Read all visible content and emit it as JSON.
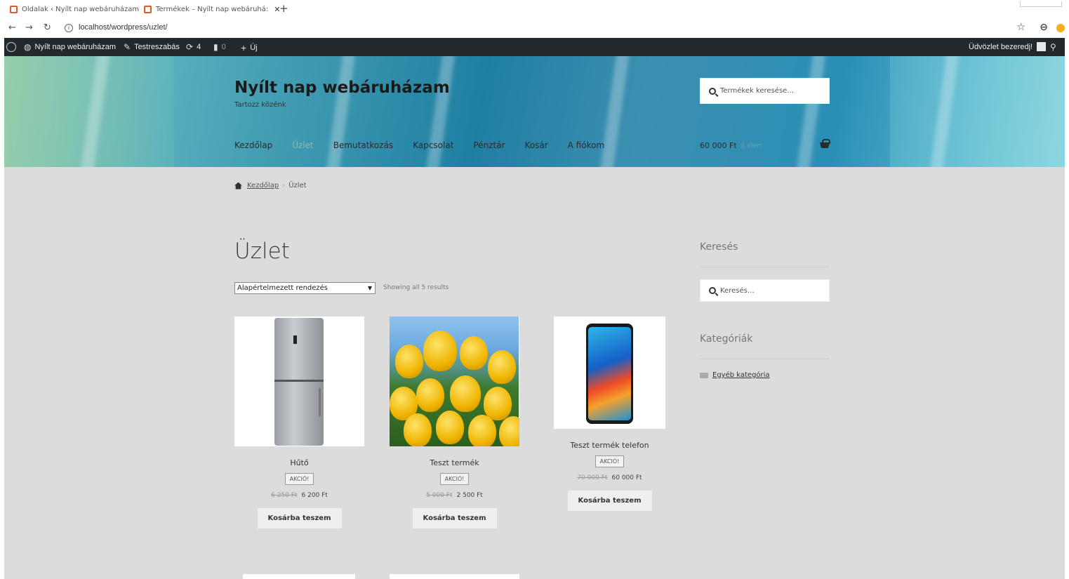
{
  "browser": {
    "tabs": [
      {
        "label": "Oldalak ‹ Nyílt nap webáruházam"
      },
      {
        "label": "Termékek – Nyílt nap webáruhá:"
      }
    ],
    "new_tab": "+",
    "url": "localhost/wordpress/uzlet/"
  },
  "adminbar": {
    "site": "Nyílt nap webáruházam",
    "customize": "Testreszabás",
    "updates": "4",
    "comments": "0",
    "new": "Új",
    "greeting": "Üdvözlet bezeredj!"
  },
  "header": {
    "site_title": "Nyílt nap webáruházam",
    "tagline": "Tartozz közénk",
    "search_placeholder": "Termékek keresése…",
    "nav": [
      "Kezdőlap",
      "Üzlet",
      "Bemutatkozás",
      "Kapcsolat",
      "Pénztár",
      "Kosár",
      "A fiókom"
    ],
    "active_nav": "Üzlet",
    "cart_total": "60 000 Ft",
    "cart_count": "1 elem"
  },
  "breadcrumb": {
    "home": "Kezdőlap",
    "separator": "›",
    "current": "Üzlet"
  },
  "page": {
    "title": "Üzlet",
    "orderby": "Alapértelmezett rendezés",
    "results": "Showing all 5 results"
  },
  "products": [
    {
      "name": "Hűtő",
      "badge": "AKCIÓ!",
      "old_price": "6 250 Ft",
      "price": "6 200 Ft",
      "button": "Kosárba teszem"
    },
    {
      "name": "Teszt termék",
      "badge": "AKCIÓ!",
      "old_price": "5 000 Ft",
      "price": "2 500 Ft",
      "button": "Kosárba teszem"
    },
    {
      "name": "Teszt termék telefon",
      "badge": "AKCIÓ!",
      "old_price": "70 000 Ft",
      "price": "60 000 Ft",
      "button": "Kosárba teszem"
    }
  ],
  "sidebar": {
    "search_title": "Keresés",
    "search_placeholder": "Keresés…",
    "categories_title": "Kategóriák",
    "categories": [
      "Egyéb kategória"
    ]
  }
}
